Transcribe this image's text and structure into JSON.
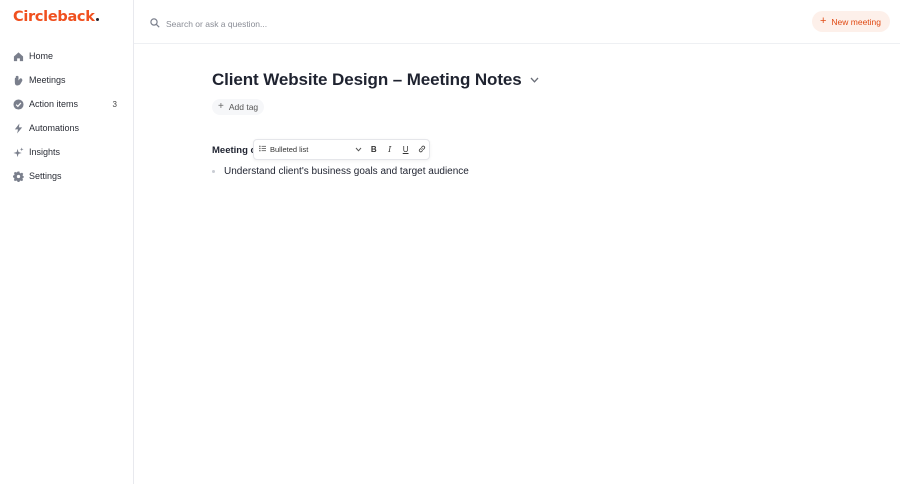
{
  "app": {
    "logo_text": "Circleback"
  },
  "sidebar": {
    "items": [
      {
        "label": "Home",
        "icon": "home-icon"
      },
      {
        "label": "Meetings",
        "icon": "meetings-icon"
      },
      {
        "label": "Action items",
        "icon": "check-circle-icon",
        "count": "3"
      },
      {
        "label": "Automations",
        "icon": "lightning-icon"
      },
      {
        "label": "Insights",
        "icon": "sparkles-icon"
      },
      {
        "label": "Settings",
        "icon": "gear-icon"
      }
    ]
  },
  "topbar": {
    "search_placeholder": "Search or ask a question...",
    "new_meeting_label": "New meeting"
  },
  "note": {
    "title": "Client Website Design – Meeting Notes",
    "add_tag_label": "Add tag",
    "section_heading_visible": "Meeting o",
    "bullets": [
      "Understand client's business goals and target audience"
    ]
  },
  "format_toolbar": {
    "block_type": "Bulleted list",
    "bold": "B",
    "italic": "I",
    "underline": "U"
  },
  "colors": {
    "brand": "#f0501f",
    "accent_bg": "#fdf0ea",
    "icon": "#7a7f8c"
  }
}
